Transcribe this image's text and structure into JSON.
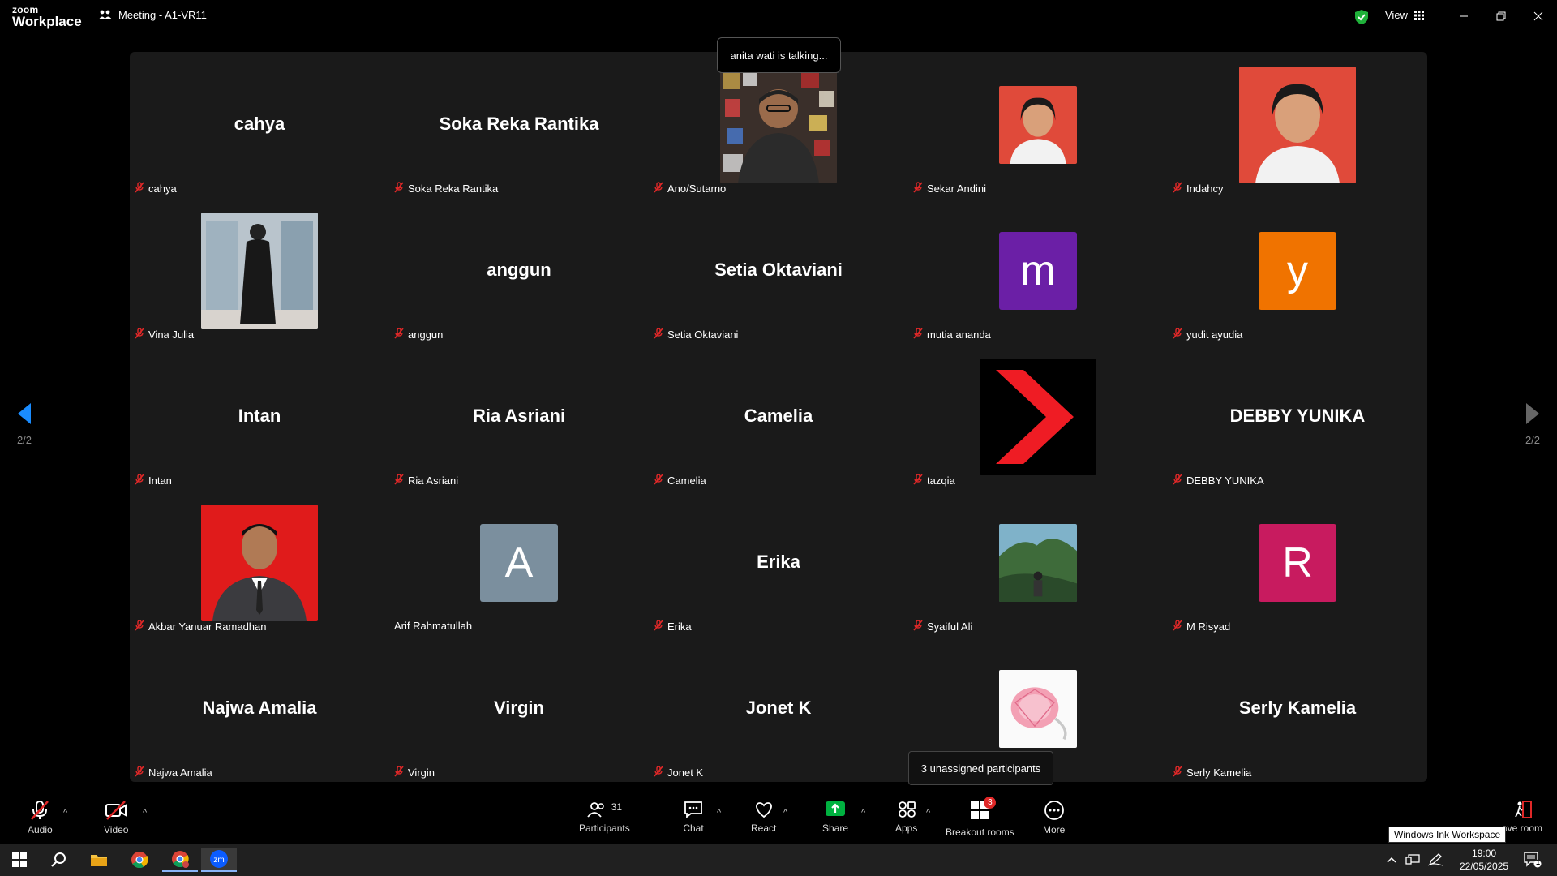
{
  "titlebar": {
    "logo_line1": "zoom",
    "logo_line2": "Workplace",
    "meeting_title": "Meeting - A1-VR11",
    "view_label": "View"
  },
  "talking_tooltip": "anita wati is talking...",
  "pager": {
    "left": "2/2",
    "right": "2/2"
  },
  "participants": [
    {
      "label": "cahya",
      "center": "cahya",
      "muted": true
    },
    {
      "label": "Soka Reka Rantika",
      "center": "Soka Reka Rantika",
      "muted": true
    },
    {
      "label": "Ano/Sutarno",
      "photo": "person-photo",
      "muted": true
    },
    {
      "label": "Sekar Andini",
      "photo": "portrait-photo",
      "muted": true
    },
    {
      "label": "Indahcy",
      "photo": "portrait-photo",
      "muted": true
    },
    {
      "label": "Vina Julia",
      "photo": "mirror-selfie-photo",
      "muted": true
    },
    {
      "label": "anggun",
      "center": "anggun",
      "muted": true
    },
    {
      "label": "Setia Oktaviani",
      "center": "Setia Oktaviani",
      "muted": true
    },
    {
      "label": "mutia ananda",
      "initial": "m",
      "color": "#6b1fa6",
      "muted": true
    },
    {
      "label": "yudit ayudia",
      "initial": "y",
      "color": "#f07300",
      "muted": true
    },
    {
      "label": "Intan",
      "center": "Intan",
      "muted": true
    },
    {
      "label": "Ria Asriani",
      "center": "Ria Asriani",
      "muted": true
    },
    {
      "label": "Camelia",
      "center": "Camelia",
      "muted": true
    },
    {
      "label": "tazqia",
      "photo": "red-chevron-logo",
      "muted": true
    },
    {
      "label": "DEBBY YUNIKA",
      "center": "DEBBY YUNIKA",
      "muted": true
    },
    {
      "label": "Akbar Yanuar Ramadhan",
      "photo": "formal-portrait-photo",
      "muted": true
    },
    {
      "label": "Arif Rahmatullah",
      "initial": "A",
      "color": "#7b8f9e",
      "muted": false
    },
    {
      "label": "Erika",
      "center": "Erika",
      "muted": true
    },
    {
      "label": "Syaiful Ali",
      "photo": "landscape-photo",
      "muted": true
    },
    {
      "label": "M Risyad",
      "initial": "R",
      "color": "#c81b5f",
      "muted": true
    },
    {
      "label": "Najwa Amalia",
      "center": "Najwa Amalia",
      "muted": true
    },
    {
      "label": "Virgin",
      "center": "Virgin",
      "muted": true
    },
    {
      "label": "Jonet K",
      "center": "Jonet K",
      "muted": true
    },
    {
      "label": "",
      "photo": "pink-diamond-ring-photo",
      "muted": false
    },
    {
      "label": "Serly Kamelia",
      "center": "Serly Kamelia",
      "muted": true
    }
  ],
  "unassigned_tooltip": "3 unassigned participants",
  "toolbar": {
    "audio": "Audio",
    "video": "Video",
    "participants": "Participants",
    "participants_count": "31",
    "chat": "Chat",
    "react": "React",
    "share": "Share",
    "apps": "Apps",
    "breakout": "Breakout rooms",
    "breakout_badge": "3",
    "more": "More",
    "leave": "ave room"
  },
  "ink_tooltip": "Windows Ink Workspace",
  "taskbar": {
    "time": "19:00",
    "date": "22/05/2025",
    "notif": "1"
  },
  "colors": {
    "accent_blue": "#0b5cff",
    "mute_red": "#e02828",
    "share_green": "#00b140"
  }
}
